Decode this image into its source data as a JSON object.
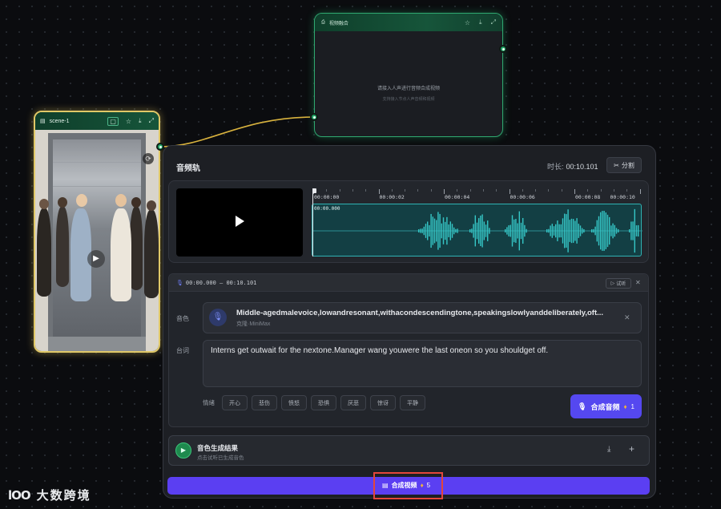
{
  "merge_node": {
    "title": "视频融合",
    "hint": "请接入人声进行音频合成视频",
    "subhint": "支持接入节点人声音频和视频",
    "icons": [
      "star-icon",
      "download-icon",
      "expand-icon"
    ]
  },
  "scene_node": {
    "title": "scene-1",
    "icons": [
      "scene-icon",
      "star-icon",
      "download-icon",
      "expand-icon"
    ]
  },
  "audio_panel": {
    "title": "音频轨",
    "duration_label": "时长:",
    "duration_value": "00:10.101",
    "split_label": "分割",
    "ruler_labels": [
      "00:00:00",
      "00:00:02",
      "00:00:04",
      "00:00:06",
      "00:00:08",
      "00:00:10"
    ],
    "track_start": "00:00.000"
  },
  "segment": {
    "time_range": "00:00.000 — 00:10.101",
    "try_label": "试听",
    "voice_label": "音色",
    "voice_name": "Middle-agedmalevoice,lowandresonant,withacondescendingtone,speakingslowlyanddeliberately,oft...",
    "voice_source": "克隆·MiniMax",
    "line_label": "台词",
    "line_text": "Interns get outwait for the nextone.Manager wang youwere the last oneon so you shouldget off.",
    "emotion_label": "情绪",
    "emotions": [
      "开心",
      "悲伤",
      "愤怒",
      "恐惧",
      "厌恶",
      "惊讶",
      "平静"
    ],
    "synth_audio_label": "合成音频",
    "synth_audio_cost": "1"
  },
  "result": {
    "title": "音色生成结果",
    "subtitle": "点击试听已生成音色"
  },
  "bottom": {
    "synth_video_label": "合成视频",
    "synth_video_cost": "5"
  },
  "watermark": {
    "logo": "lOO",
    "text": "大数跨境"
  },
  "colors": {
    "accent_purple": "#5548f0",
    "node_green": "#21a768",
    "selection_gold": "#e0c867",
    "waveform_teal": "#35c6c6",
    "highlight_red": "#e3463b"
  }
}
